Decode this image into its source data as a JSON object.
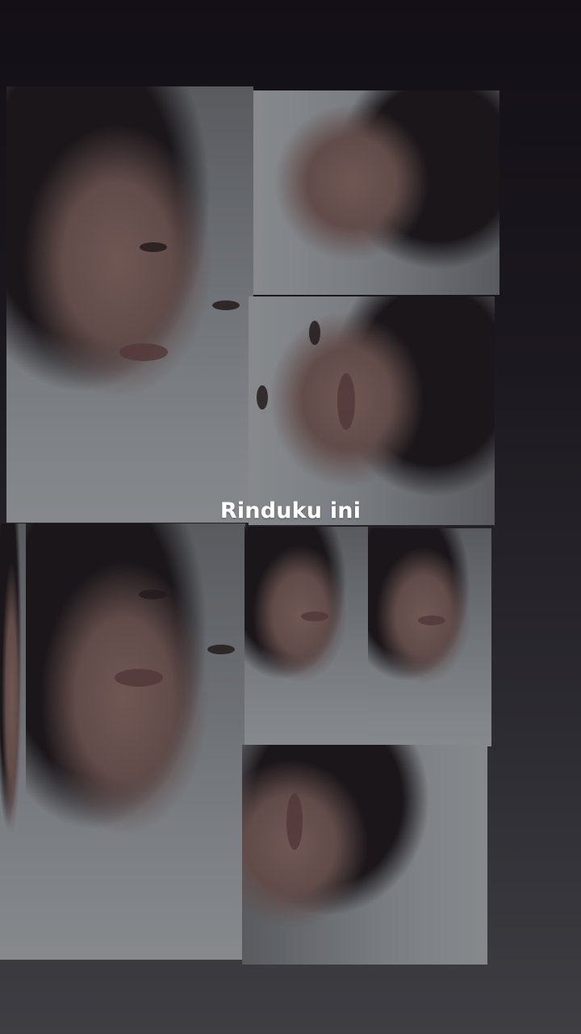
{
  "story": {
    "caption": "Rinduku ini"
  },
  "collage": {
    "photos": [
      {
        "name": "photo-selfie-large-top-left",
        "orientation": "portrait"
      },
      {
        "name": "photo-selfie-top-right-rotated",
        "orientation": "rotated-right"
      },
      {
        "name": "photo-selfie-middle-right-rotated",
        "orientation": "rotated-right"
      },
      {
        "name": "photo-selfie-left-edge-partial",
        "orientation": "portrait"
      },
      {
        "name": "photo-selfie-large-bottom-left",
        "orientation": "portrait"
      },
      {
        "name": "photo-selfie-small-center",
        "orientation": "portrait"
      },
      {
        "name": "photo-selfie-small-right",
        "orientation": "portrait"
      },
      {
        "name": "photo-selfie-bottom-right-rotated",
        "orientation": "rotated-left"
      }
    ]
  },
  "colors": {
    "background_top": "#130f16",
    "background_bottom": "#3e3e43",
    "caption_text": "#ffffff"
  }
}
